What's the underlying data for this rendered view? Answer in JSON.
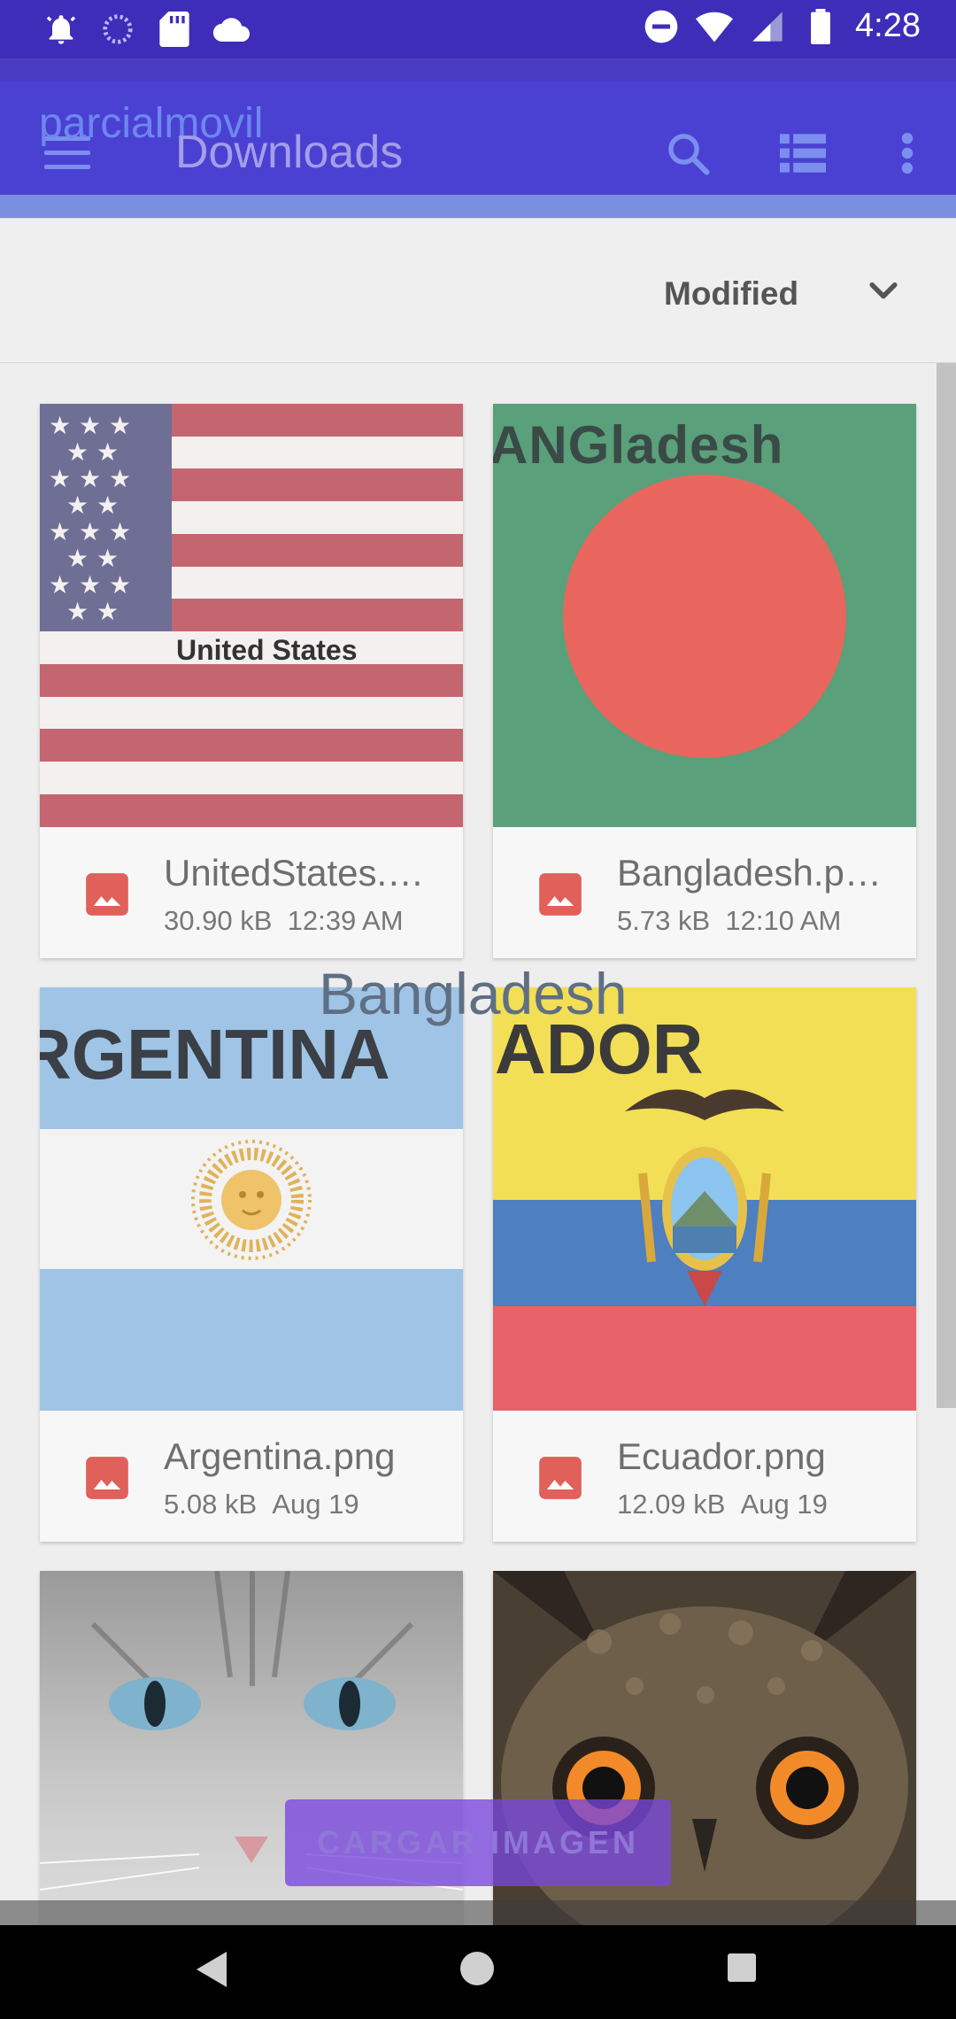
{
  "status_bar": {
    "time": "4:28",
    "left_icons": [
      "alarm-bell-icon",
      "loading-circle-icon",
      "sd-card-icon",
      "cloud-icon"
    ],
    "right_icons": [
      "do-not-disturb-icon",
      "wifi-icon",
      "signal-icon",
      "battery-icon"
    ]
  },
  "app": {
    "name": "parcialmovil",
    "title": "Downloads",
    "actions": [
      "search-icon",
      "list-view-icon",
      "more-vert-icon"
    ]
  },
  "sort": {
    "label": "Modified"
  },
  "files": [
    {
      "name": "UnitedStates.…",
      "size": "30.90 kB",
      "date": "12:39 AM",
      "thumb_text": "United States"
    },
    {
      "name": "Bangladesh.p…",
      "size": "5.73 kB",
      "date": "12:10 AM",
      "thumb_text": "ANGladesh"
    },
    {
      "name": "Argentina.png",
      "size": "5.08 kB",
      "date": "Aug 19",
      "thumb_text": "RGENTINA"
    },
    {
      "name": "Ecuador.png",
      "size": "12.09 kB",
      "date": "Aug 19",
      "thumb_text": "ADOR"
    }
  ],
  "overlay": {
    "selected_title": "Bangladesh",
    "button": "CARGAR IMAGEN"
  },
  "colors": {
    "status_bar": "#3e2db8",
    "app_bar": "#4a41d3",
    "file_icon": "#e0605a",
    "button": "#7846dc"
  }
}
